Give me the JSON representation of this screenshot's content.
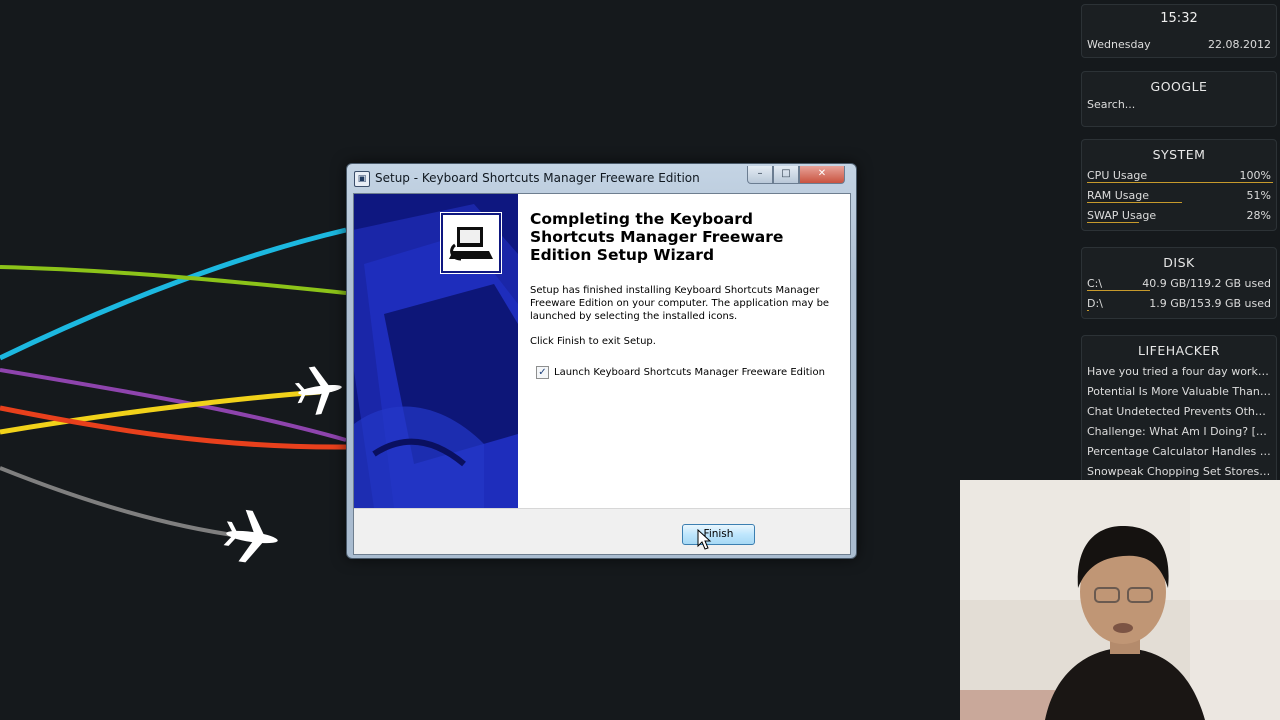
{
  "desktop": {
    "flight_lines": [
      {
        "color": "#1cb8e0"
      },
      {
        "color": "#8cc319"
      },
      {
        "color": "#8e44ad"
      },
      {
        "color": "#f1d21a"
      },
      {
        "color": "#e8401c"
      },
      {
        "color": "#7f7f7f"
      }
    ]
  },
  "gadgets": {
    "clock": {
      "time": "15:32",
      "day": "Wednesday",
      "date": "22.08.2012"
    },
    "google": {
      "title": "GOOGLE",
      "placeholder": "Search..."
    },
    "system": {
      "title": "SYSTEM",
      "rows": [
        {
          "label": "CPU Usage",
          "value": "100%",
          "fill": 1.0
        },
        {
          "label": "RAM Usage",
          "value": "51%",
          "fill": 0.51
        },
        {
          "label": "SWAP Usage",
          "value": "28%",
          "fill": 0.28
        }
      ]
    },
    "disk": {
      "title": "DISK",
      "rows": [
        {
          "label": "C:\\",
          "value": "40.9 GB/119.2 GB used",
          "fill": 0.34
        },
        {
          "label": "D:\\",
          "value": "1.9 GB/153.9 GB used",
          "fill": 0.01
        }
      ]
    },
    "lifehacker": {
      "title": "LIFEHACKER",
      "items": [
        "Have you tried a four day work we...",
        "Potential Is More Valuable Than Ex...",
        "Chat Undetected Prevents Others...",
        "Challenge: What Am I Doing? [Sear...",
        "Percentage Calculator Handles Co...",
        "Snowpeak Chopping Set Stores Yo..."
      ]
    }
  },
  "dialog": {
    "title": "Setup - Keyboard Shortcuts Manager Freeware Edition",
    "heading": "Completing the Keyboard Shortcuts Manager Freeware Edition Setup Wizard",
    "body": "Setup has finished installing Keyboard Shortcuts Manager Freeware Edition on your computer. The application may be launched by selecting the installed icons.",
    "exit_hint": "Click Finish to exit Setup.",
    "launch_label": "Launch Keyboard Shortcuts Manager Freeware Edition",
    "launch_checked": true,
    "finish_label": "Finish",
    "accent": "#0e1780"
  }
}
